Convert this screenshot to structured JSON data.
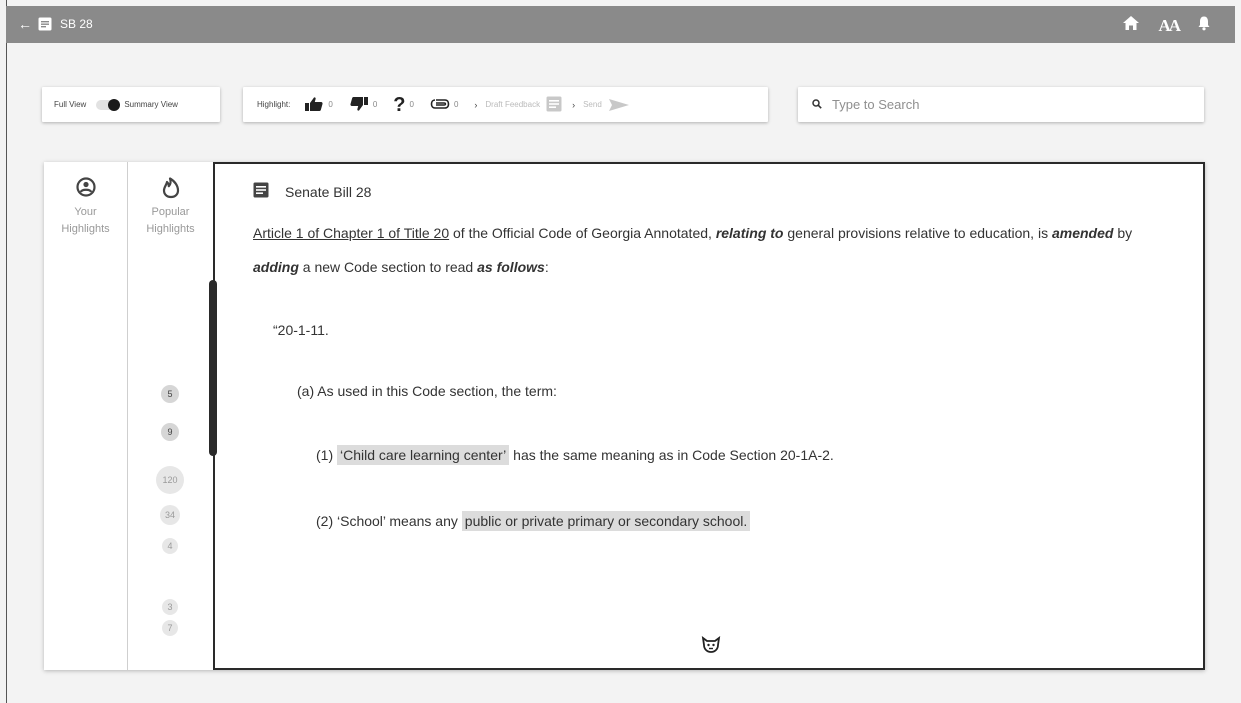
{
  "appbar": {
    "back_icon": "arrow-left-icon",
    "doc_icon": "document-icon",
    "title": "SB 28",
    "actions": [
      "home-icon",
      "text-size-icon",
      "bell-icon"
    ],
    "text_size_label": "AA",
    "bar_color": "#8a8a8a"
  },
  "toolbar": {
    "view_toggle": {
      "left_label": "Full View",
      "right_label": "Summary View",
      "selected": "Summary View"
    },
    "highlight": {
      "label": "Highlight:",
      "items": [
        {
          "icon": "thumbs-up-icon",
          "count": "0"
        },
        {
          "icon": "thumbs-down-icon",
          "count": "0"
        },
        {
          "icon": "question-icon",
          "count": "0"
        },
        {
          "icon": "paperclip-icon",
          "count": "0"
        }
      ],
      "draft_label": "Draft Feedback",
      "send_label": "Send"
    },
    "search": {
      "placeholder": "Type to Search",
      "value": ""
    }
  },
  "sidebar": {
    "your": {
      "icon": "person-icon",
      "label_1": "Your",
      "label_2": "Highlights"
    },
    "popular": {
      "icon": "flame-icon",
      "label_1": "Popular",
      "label_2": "Highlights"
    },
    "counts": [
      "5",
      "9",
      "120",
      "34",
      "4",
      "3",
      "7"
    ]
  },
  "document": {
    "title": "Senate Bill 28",
    "intro": {
      "link": "Article 1 of Chapter 1 of Title 20",
      "t1": " of the Official Code of Georgia Annotated, ",
      "b1": "relating to",
      "t2": " general provisions relative to education, is ",
      "b2": "amended",
      "t3": " by ",
      "b3": "adding",
      "t4": " a new Code section to read ",
      "b4": "as follows",
      "t5": ":"
    },
    "section_number": "“20-1-11.",
    "clause_a": "(a) As used in this Code section, the term:",
    "item1": {
      "prefix": "(1) ",
      "highlight": "‘Child care learning center’",
      "rest": " has the same meaning as in Code Section 20-1A-2."
    },
    "item2": {
      "prefix": "(2) ‘School’ means any ",
      "highlight": "public or private primary or secondary school."
    },
    "highlight_color": "#dcdcdc"
  }
}
